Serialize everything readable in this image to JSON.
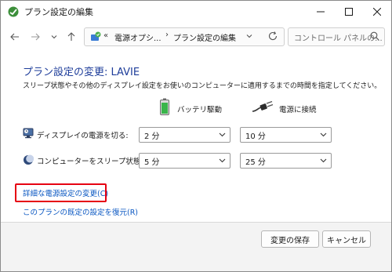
{
  "window": {
    "title": "プラン設定の編集",
    "minimize_icon": "minimize-icon",
    "maximize_icon": "maximize-icon",
    "close_icon": "close-icon"
  },
  "nav": {
    "back_icon": "arrow-left-icon",
    "forward_icon": "arrow-right-icon",
    "recent_icon": "chevron-down-icon",
    "up_icon": "arrow-up-icon"
  },
  "address": {
    "overflow": "«",
    "crumb1": "電源オプシ...",
    "separator": "›",
    "crumb2": "プラン設定の編集",
    "dropdown_icon": "chevron-down-icon",
    "refresh_icon": "refresh-icon"
  },
  "search": {
    "placeholder": "コントロール パネルの...",
    "icon": "search-icon"
  },
  "main": {
    "heading": "プラン設定の変更: LAVIE",
    "description": "スリープ状態やその他のディスプレイ設定をお使いのコンピューターに適用するまでの時間を指定してください。",
    "columns": {
      "battery": "バッテリ駆動",
      "plugged": "電源に接続"
    },
    "rows": [
      {
        "label": "ディスプレイの電源を切る:",
        "battery": "2 分",
        "plugged": "10 分",
        "icon": "monitor-icon"
      },
      {
        "label": "コンピューターをスリープ状態にする:",
        "battery": "5 分",
        "plugged": "25 分",
        "icon": "moon-icon"
      }
    ],
    "links": {
      "advanced": "詳細な電源設定の変更(C)",
      "restore": "このプランの既定の設定を復元(R)"
    },
    "colors": {
      "heading": "#1e3d9a",
      "link": "#0a57c2",
      "highlight": "#e60012"
    }
  },
  "footer": {
    "save": "変更の保存",
    "cancel": "キャンセル"
  }
}
